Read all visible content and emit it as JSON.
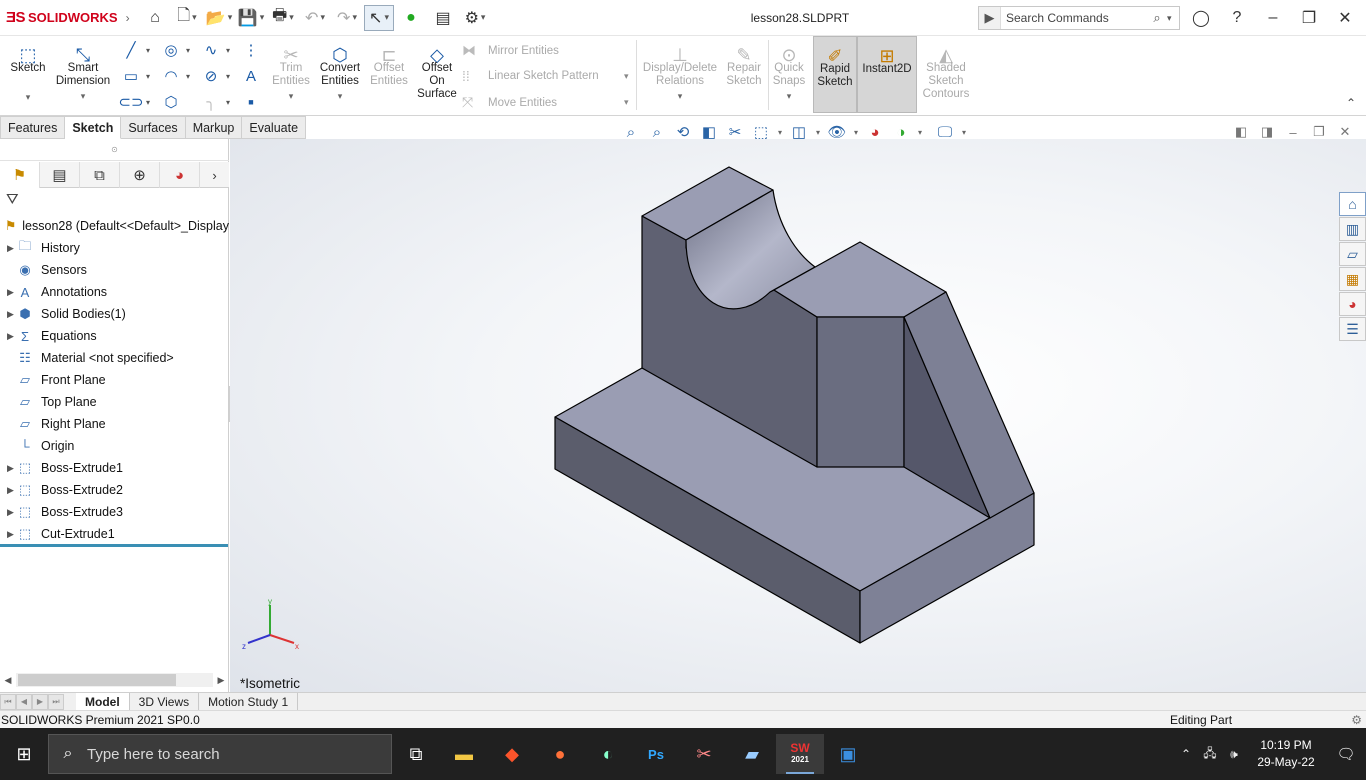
{
  "app": {
    "brand_logo": "ƎS",
    "brand_name": "SOLIDWORKS",
    "document_title": "lesson28.SLDPRT"
  },
  "search": {
    "placeholder": "Search Commands"
  },
  "ribbon": {
    "sketch": "Sketch",
    "smart_dimension": [
      "Smart",
      "Dimension"
    ],
    "trim_entities": [
      "Trim",
      "Entities"
    ],
    "convert_entities": [
      "Convert",
      "Entities"
    ],
    "offset_entities": [
      "Offset",
      "Entities"
    ],
    "offset_on_surface": [
      "Offset",
      "On",
      "Surface"
    ],
    "mirror_entities": "Mirror Entities",
    "linear_sketch_pattern": "Linear Sketch Pattern",
    "move_entities": "Move Entities",
    "display_delete_relations": [
      "Display/Delete",
      "Relations"
    ],
    "repair_sketch": [
      "Repair",
      "Sketch"
    ],
    "quick_snaps": [
      "Quick",
      "Snaps"
    ],
    "rapid_sketch": [
      "Rapid",
      "Sketch"
    ],
    "instant2d": "Instant2D",
    "shaded_sketch_contours": [
      "Shaded",
      "Sketch",
      "Contours"
    ]
  },
  "tabs": [
    "Features",
    "Sketch",
    "Surfaces",
    "Markup",
    "Evaluate"
  ],
  "active_tab": "Sketch",
  "feature_tree": {
    "root": "lesson28  (Default<<Default>_Display",
    "items": [
      {
        "label": "History",
        "icon": "history-folder-icon",
        "expandable": true
      },
      {
        "label": "Sensors",
        "icon": "sensors-icon",
        "expandable": false
      },
      {
        "label": "Annotations",
        "icon": "annotations-icon",
        "expandable": true
      },
      {
        "label": "Solid Bodies(1)",
        "icon": "solid-bodies-icon",
        "expandable": true
      },
      {
        "label": "Equations",
        "icon": "equations-icon",
        "expandable": true
      },
      {
        "label": "Material <not specified>",
        "icon": "material-icon",
        "expandable": false
      },
      {
        "label": "Front Plane",
        "icon": "plane-icon",
        "expandable": false
      },
      {
        "label": "Top Plane",
        "icon": "plane-icon",
        "expandable": false
      },
      {
        "label": "Right Plane",
        "icon": "plane-icon",
        "expandable": false
      },
      {
        "label": "Origin",
        "icon": "origin-icon",
        "expandable": false
      },
      {
        "label": "Boss-Extrude1",
        "icon": "boss-extrude-icon",
        "expandable": true
      },
      {
        "label": "Boss-Extrude2",
        "icon": "boss-extrude-icon",
        "expandable": true
      },
      {
        "label": "Boss-Extrude3",
        "icon": "boss-extrude-icon",
        "expandable": true
      },
      {
        "label": "Cut-Extrude1",
        "icon": "cut-extrude-icon",
        "expandable": true
      }
    ]
  },
  "viewport": {
    "view_label": "*Isometric",
    "triad": {
      "x": "x",
      "y": "y",
      "z": "z"
    }
  },
  "bottom_tabs": [
    "Model",
    "3D Views",
    "Motion Study 1"
  ],
  "active_bottom_tab": "Model",
  "status": {
    "left": "SOLIDWORKS Premium 2021 SP0.0",
    "right": "Editing Part"
  },
  "taskbar": {
    "search_placeholder": "Type here to search",
    "time": "10:19 PM",
    "date": "29-May-22",
    "apps": [
      "task-view-icon",
      "file-explorer-icon",
      "brave-browser-icon",
      "firefox-icon",
      "paint-icon",
      "photoshop-icon",
      "snipping-icon",
      "notepad-icon",
      "solidworks-2021-icon",
      "photos-icon"
    ],
    "solidworks_badge": "2021"
  },
  "colors": {
    "brand_red": "#d0021b",
    "model_face_top": "#9a9db3",
    "model_face_side_dark": "#5b5d6c",
    "model_face_side_mid": "#767a8f",
    "accent_blue": "#1a5aa6"
  }
}
